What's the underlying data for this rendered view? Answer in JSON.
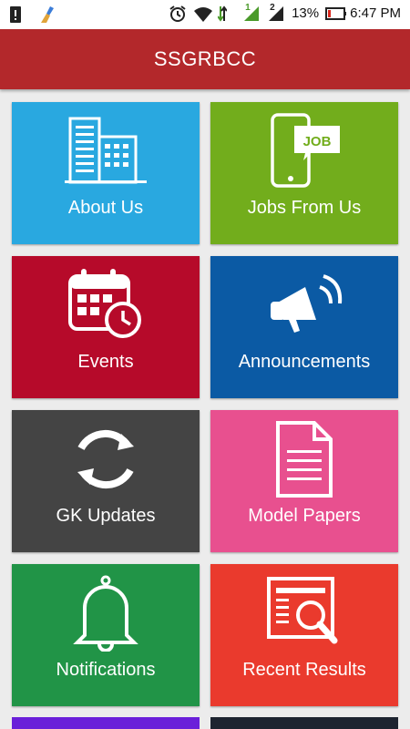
{
  "status_bar": {
    "battery_percent": "13%",
    "time": "6:47 PM",
    "sim1_label": "1",
    "sim2_label": "2"
  },
  "app": {
    "title": "SSGRBCC"
  },
  "tiles": [
    {
      "label": "About Us",
      "icon": "building-icon",
      "color": "#29a8e0"
    },
    {
      "label": "Jobs From Us",
      "icon": "phone-job-icon",
      "color": "#72ad1c",
      "icon_text": "JOB"
    },
    {
      "label": "Events",
      "icon": "calendar-clock-icon",
      "color": "#b60a2a"
    },
    {
      "label": "Announcements",
      "icon": "megaphone-icon",
      "color": "#0b5aa4"
    },
    {
      "label": "GK Updates",
      "icon": "refresh-icon",
      "color": "#444444"
    },
    {
      "label": "Model Papers",
      "icon": "document-icon",
      "color": "#e8508f"
    },
    {
      "label": "Notifications",
      "icon": "bell-icon",
      "color": "#219447"
    },
    {
      "label": "Recent Results",
      "icon": "search-results-icon",
      "color": "#ea3a2d"
    }
  ],
  "partial_tiles": [
    {
      "color": "#6a1fd9"
    },
    {
      "color": "#1d2430"
    }
  ]
}
